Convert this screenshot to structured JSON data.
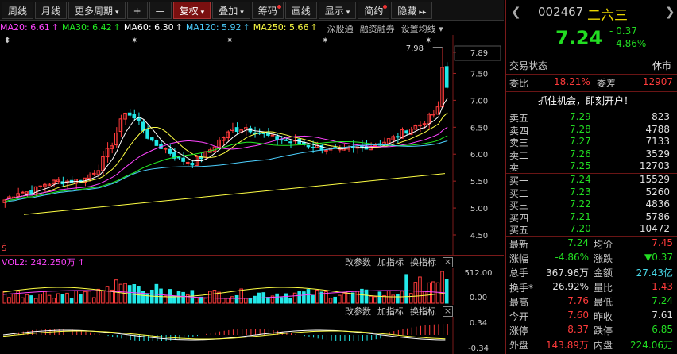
{
  "toolbar": {
    "items": [
      {
        "label": "周线"
      },
      {
        "label": "月线"
      },
      {
        "label": "更多周期",
        "arrow": "▾"
      },
      {
        "label": "+"
      },
      {
        "label": "—"
      },
      {
        "label": "复权",
        "arrow": "▾",
        "selected": true
      },
      {
        "label": "叠加",
        "arrow": "▾"
      },
      {
        "label": "筹码",
        "dot": true
      },
      {
        "label": "画线"
      },
      {
        "label": "显示",
        "arrow": "▾"
      },
      {
        "label": "简约",
        "dot": true
      },
      {
        "label": "隐藏",
        "arrow": "▸▸"
      }
    ]
  },
  "ma": [
    {
      "label": "MA20: 6.61",
      "color": "#ff44ff"
    },
    {
      "label": "MA30: 6.42",
      "color": "#22ee22"
    },
    {
      "label": "MA60: 6.30",
      "color": "#ffffff"
    },
    {
      "label": "MA120: 5.92",
      "color": "#4cd0ff"
    },
    {
      "label": "MA250: 5.66",
      "color": "#ffff44"
    }
  ],
  "ma_links": [
    "深股通",
    "融资融券",
    "设置均线"
  ],
  "price_axis": [
    "7.89",
    "7.50",
    "7.00",
    "6.50",
    "6.00",
    "5.50",
    "5.00",
    "4.50"
  ],
  "max_label": "7.98",
  "vol": {
    "label": "VOL2: 242.250万",
    "btn1": "改参数",
    "btn2": "加指标",
    "btn3": "换指标",
    "ax_top": "512.00",
    "ax_bot": "0.00"
  },
  "macd": {
    "btn1": "改参数",
    "btn2": "加指标",
    "btn3": "换指标",
    "ax_top": "0.34",
    "ax_bot": "-0.34"
  },
  "stock": {
    "code": "002467",
    "name": "二六三",
    "price": "7.24",
    "change": "- 0.37",
    "pct": "- 4.86%"
  },
  "trade_status": {
    "label": "交易状态",
    "value": "休市"
  },
  "weibi": {
    "label": "委比",
    "value": "18.21%",
    "label2": "委差",
    "value2": "12907"
  },
  "promo": "抓住机会，即刻开户！",
  "asks": [
    {
      "label": "卖五",
      "price": "7.29",
      "vol": "823"
    },
    {
      "label": "卖四",
      "price": "7.28",
      "vol": "4788"
    },
    {
      "label": "卖三",
      "price": "7.27",
      "vol": "7133"
    },
    {
      "label": "卖二",
      "price": "7.26",
      "vol": "3529"
    },
    {
      "label": "卖一",
      "price": "7.25",
      "vol": "12703"
    }
  ],
  "bids": [
    {
      "label": "买一",
      "price": "7.24",
      "vol": "15529"
    },
    {
      "label": "买二",
      "price": "7.23",
      "vol": "5260"
    },
    {
      "label": "买三",
      "price": "7.22",
      "vol": "4836"
    },
    {
      "label": "买四",
      "price": "7.21",
      "vol": "5786"
    },
    {
      "label": "买五",
      "price": "7.20",
      "vol": "10472"
    }
  ],
  "stats": [
    {
      "l1": "最新",
      "v1": "7.24",
      "c1": "grn",
      "l2": "均价",
      "v2": "7.45",
      "c2": "red"
    },
    {
      "l1": "涨幅",
      "v1": "-4.86%",
      "c1": "grn",
      "l2": "涨跌",
      "v2": "▼0.37",
      "c2": "grn"
    },
    {
      "l1": "总手",
      "v1": "367.96万",
      "c1": "wht",
      "l2": "金额",
      "v2": "27.43亿",
      "c2": "cyan"
    },
    {
      "l1": "换手*",
      "v1": "26.92%",
      "c1": "wht",
      "l2": "量比",
      "v2": "1.43",
      "c2": "red"
    },
    {
      "l1": "最高",
      "v1": "7.76",
      "c1": "red",
      "l2": "最低",
      "v2": "7.24",
      "c2": "grn"
    },
    {
      "l1": "今开",
      "v1": "7.60",
      "c1": "red",
      "l2": "昨收",
      "v2": "7.61",
      "c2": "wht"
    },
    {
      "l1": "涨停",
      "v1": "8.37",
      "c1": "red",
      "l2": "跌停",
      "v2": "6.85",
      "c2": "grn"
    },
    {
      "l1": "外盘",
      "v1": "143.89万",
      "c1": "red",
      "l2": "内盘",
      "v2": "224.06万",
      "c2": "grn"
    }
  ],
  "colors": {
    "up": "#ff3b3b",
    "down": "#22e8e8",
    "accent": "#7a1a1a"
  }
}
